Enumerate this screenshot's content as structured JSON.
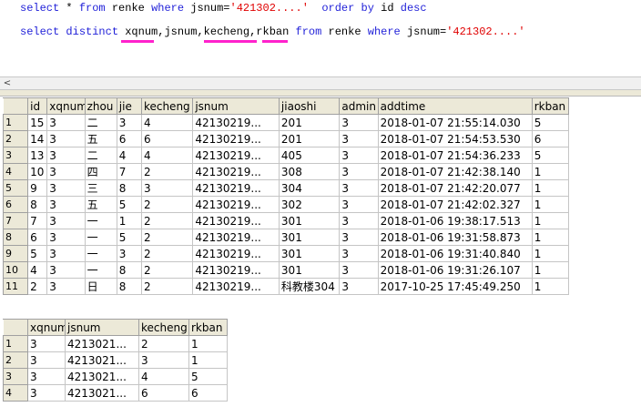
{
  "query_editor": {
    "line1": {
      "kw_select": "select",
      "star": " * ",
      "kw_from": "from",
      "table": " renke ",
      "kw_where": "where",
      "col": " jsnum=",
      "literal": "'421302....'",
      "space": "  ",
      "kw_order": "order by",
      "order_col": " id ",
      "kw_desc": "desc"
    },
    "line2": {
      "kw_select": "select",
      "sp1": " ",
      "kw_distinct": "distinct",
      "sp2": " ",
      "c1": "xqnum",
      "comma1": ",",
      "c2": "jsnum",
      "comma2": ",",
      "c3": "kecheng",
      "comma3": ",",
      "c4": "rkban",
      "sp3": " ",
      "kw_from": "from",
      "table": " renke ",
      "kw_where": "where",
      "col": " jsnum=",
      "literal": "'421302....'"
    },
    "highlight_color": "#ff22cc"
  },
  "scroll_left_arrow": "<",
  "results1": {
    "columns": [
      "id",
      "xqnum",
      "zhou",
      "jie",
      "kecheng",
      "jsnum",
      "jiaoshi",
      "admin",
      "addtime",
      "rkban"
    ],
    "rows": [
      [
        "1",
        "15",
        "3",
        "二",
        "3",
        "4",
        "42130219...",
        "201",
        "3",
        "2018-01-07 21:55:14.030",
        "5"
      ],
      [
        "2",
        "14",
        "3",
        "五",
        "6",
        "6",
        "42130219...",
        "201",
        "3",
        "2018-01-07 21:54:53.530",
        "6"
      ],
      [
        "3",
        "13",
        "3",
        "二",
        "4",
        "4",
        "42130219...",
        "405",
        "3",
        "2018-01-07 21:54:36.233",
        "5"
      ],
      [
        "4",
        "10",
        "3",
        "四",
        "7",
        "2",
        "42130219...",
        "308",
        "3",
        "2018-01-07 21:42:38.140",
        "1"
      ],
      [
        "5",
        "9",
        "3",
        "三",
        "8",
        "3",
        "42130219...",
        "304",
        "3",
        "2018-01-07 21:42:20.077",
        "1"
      ],
      [
        "6",
        "8",
        "3",
        "五",
        "5",
        "2",
        "42130219...",
        "302",
        "3",
        "2018-01-07 21:42:02.327",
        "1"
      ],
      [
        "7",
        "7",
        "3",
        "一",
        "1",
        "2",
        "42130219...",
        "301",
        "3",
        "2018-01-06 19:38:17.513",
        "1"
      ],
      [
        "8",
        "6",
        "3",
        "一",
        "5",
        "2",
        "42130219...",
        "301",
        "3",
        "2018-01-06 19:31:58.873",
        "1"
      ],
      [
        "9",
        "5",
        "3",
        "一",
        "3",
        "2",
        "42130219...",
        "301",
        "3",
        "2018-01-06 19:31:40.840",
        "1"
      ],
      [
        "10",
        "4",
        "3",
        "一",
        "8",
        "2",
        "42130219...",
        "301",
        "3",
        "2018-01-06 19:31:26.107",
        "1"
      ],
      [
        "11",
        "2",
        "3",
        "日",
        "8",
        "2",
        "42130219...",
        "科教楼304",
        "3",
        "2017-10-25 17:45:49.250",
        "1"
      ]
    ]
  },
  "results2": {
    "columns": [
      "xqnum",
      "jsnum",
      "kecheng",
      "rkban"
    ],
    "rows": [
      [
        "1",
        "3",
        "4213021...",
        "2",
        "1"
      ],
      [
        "2",
        "3",
        "4213021...",
        "3",
        "1"
      ],
      [
        "3",
        "3",
        "4213021...",
        "4",
        "5"
      ],
      [
        "4",
        "3",
        "4213021...",
        "6",
        "6"
      ]
    ]
  }
}
